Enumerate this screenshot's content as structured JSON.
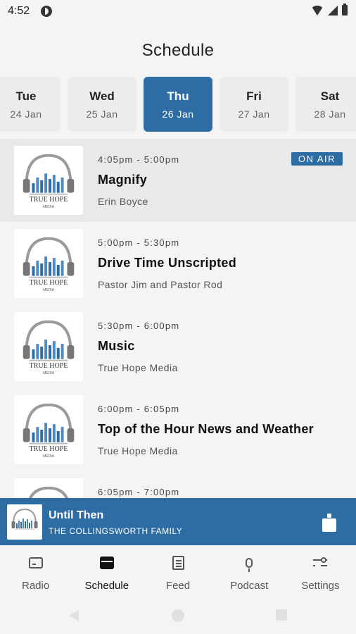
{
  "status_bar": {
    "time": "4:52"
  },
  "header": {
    "title": "Schedule"
  },
  "days": [
    {
      "day": "Tue",
      "date": "24 Jan",
      "selected": false
    },
    {
      "day": "Wed",
      "date": "25 Jan",
      "selected": false
    },
    {
      "day": "Thu",
      "date": "26 Jan",
      "selected": true
    },
    {
      "day": "Fri",
      "date": "27 Jan",
      "selected": false
    },
    {
      "day": "Sat",
      "date": "28 Jan",
      "selected": false
    }
  ],
  "schedule": [
    {
      "time": "4:05pm - 5:00pm",
      "title": "Magnify",
      "host": "Erin Boyce",
      "on_air": true
    },
    {
      "time": "5:00pm - 5:30pm",
      "title": "Drive Time Unscripted",
      "host": "Pastor Jim and Pastor Rod",
      "on_air": false
    },
    {
      "time": "5:30pm - 6:00pm",
      "title": "Music",
      "host": "True Hope Media",
      "on_air": false
    },
    {
      "time": "6:00pm - 6:05pm",
      "title": "Top of the Hour News and Weather",
      "host": "True Hope Media",
      "on_air": false
    },
    {
      "time": "6:05pm - 7:00pm",
      "title": "",
      "host": "",
      "on_air": false
    }
  ],
  "on_air_label": "ON AIR",
  "logo": {
    "brand_text": "TRUE HOPE",
    "sub_text": "MEDIA"
  },
  "now_playing": {
    "title": "Until Then",
    "artist": "THE COLLINGSWORTH FAMILY"
  },
  "nav": [
    {
      "label": "Radio",
      "icon": "radio-icon",
      "active": false
    },
    {
      "label": "Schedule",
      "icon": "calendar-icon",
      "active": true
    },
    {
      "label": "Feed",
      "icon": "feed-icon",
      "active": false
    },
    {
      "label": "Podcast",
      "icon": "microphone-icon",
      "active": false
    },
    {
      "label": "Settings",
      "icon": "sliders-icon",
      "active": false
    }
  ],
  "colors": {
    "accent": "#2e6da4",
    "background": "#f4f4f4",
    "on_air_row": "#e9e9e9"
  }
}
